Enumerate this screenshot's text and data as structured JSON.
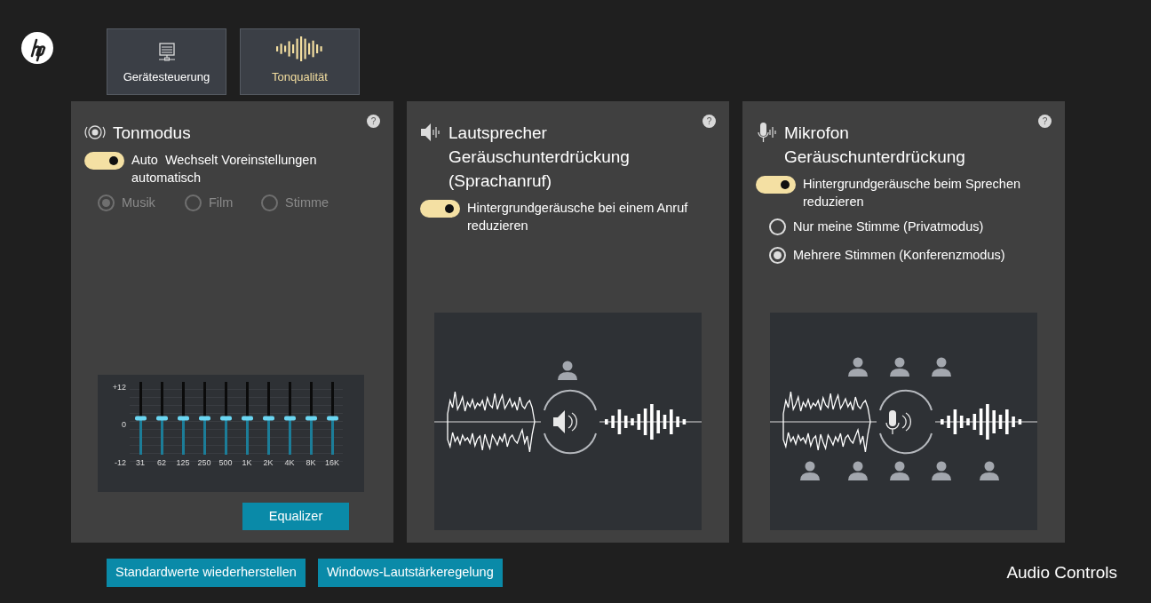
{
  "tabs": [
    {
      "label": "Gerätesteuerung",
      "selected": false
    },
    {
      "label": "Tonqualität",
      "selected": true
    }
  ],
  "panels": [
    {
      "kind": "mode",
      "title_lines": [
        "Tonmodus"
      ],
      "help": "?",
      "toggle": {
        "on": true,
        "label": "Auto  Wechselt Voreinstellungen automatisch"
      },
      "options": [
        {
          "label": "Musik",
          "selected": true,
          "disabled": true
        },
        {
          "label": "Film",
          "selected": false,
          "disabled": true
        },
        {
          "label": "Stimme",
          "selected": false,
          "disabled": true
        }
      ],
      "equalizer": {
        "y_labels": [
          "+12",
          "0",
          "-12"
        ],
        "bands": [
          {
            "label": "31",
            "level": 0.5
          },
          {
            "label": "62",
            "level": 0.5
          },
          {
            "label": "125",
            "level": 0.5
          },
          {
            "label": "250",
            "level": 0.5
          },
          {
            "label": "500",
            "level": 0.5
          },
          {
            "label": "1K",
            "level": 0.5
          },
          {
            "label": "2K",
            "level": 0.5
          },
          {
            "label": "4K",
            "level": 0.5
          },
          {
            "label": "8K",
            "level": 0.5
          },
          {
            "label": "16K",
            "level": 0.5
          }
        ]
      },
      "button": "Equalizer"
    },
    {
      "kind": "speaker",
      "title_lines": [
        "Lautsprecher",
        "Geräuschunterdrückung",
        "(Sprachanruf)"
      ],
      "help": "?",
      "toggle": {
        "on": true,
        "label": "Hintergrundgeräusche bei einem Anruf reduzieren"
      }
    },
    {
      "kind": "microphone",
      "title_lines": [
        "Mikrofon",
        "Geräuschunterdrückung"
      ],
      "help": "?",
      "toggle": {
        "on": true,
        "label": "Hintergrundgeräusche beim Sprechen reduzieren"
      },
      "options": [
        {
          "label": "Nur meine Stimme (Privatmodus)",
          "selected": false,
          "disabled": false
        },
        {
          "label": "Mehrere Stimmen (Konferenzmodus)",
          "selected": true,
          "disabled": false
        }
      ]
    }
  ],
  "footer_buttons": [
    "Standardwerte wiederherstellen",
    "Windows-Lautstärkeregelung"
  ],
  "app_title": "Audio Controls"
}
